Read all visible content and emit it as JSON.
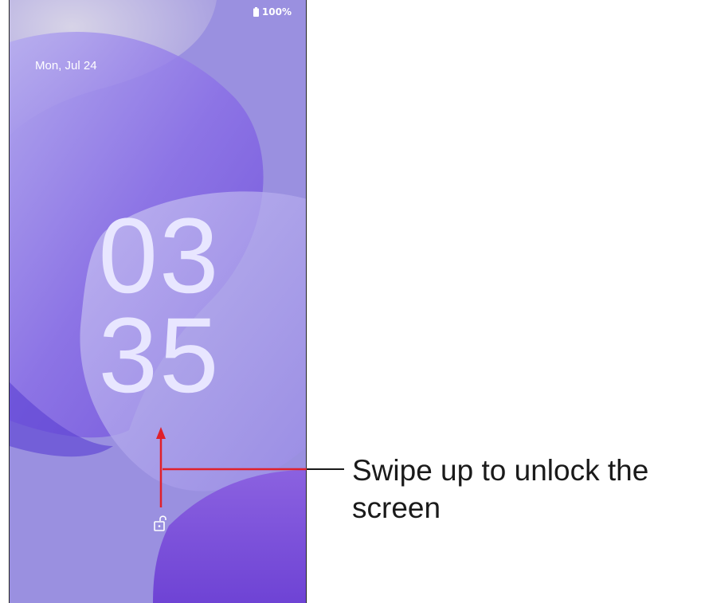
{
  "status_bar": {
    "battery_icon": "battery-full-icon",
    "battery_level": "100%"
  },
  "lock_screen": {
    "date": "Mon, Jul 24",
    "clock_hour": "03",
    "clock_minute": "35",
    "lock_icon": "unlock-icon"
  },
  "annotation": {
    "caption": "Swipe up to unlock the screen",
    "arrow_color": "#e0202a",
    "callout_line_color": "#1a1a1a"
  },
  "colors": {
    "wallpaper_primary": "#8e7fe0",
    "wallpaper_deep": "#5b3fd6",
    "clock_text": "#e8e6ff"
  }
}
